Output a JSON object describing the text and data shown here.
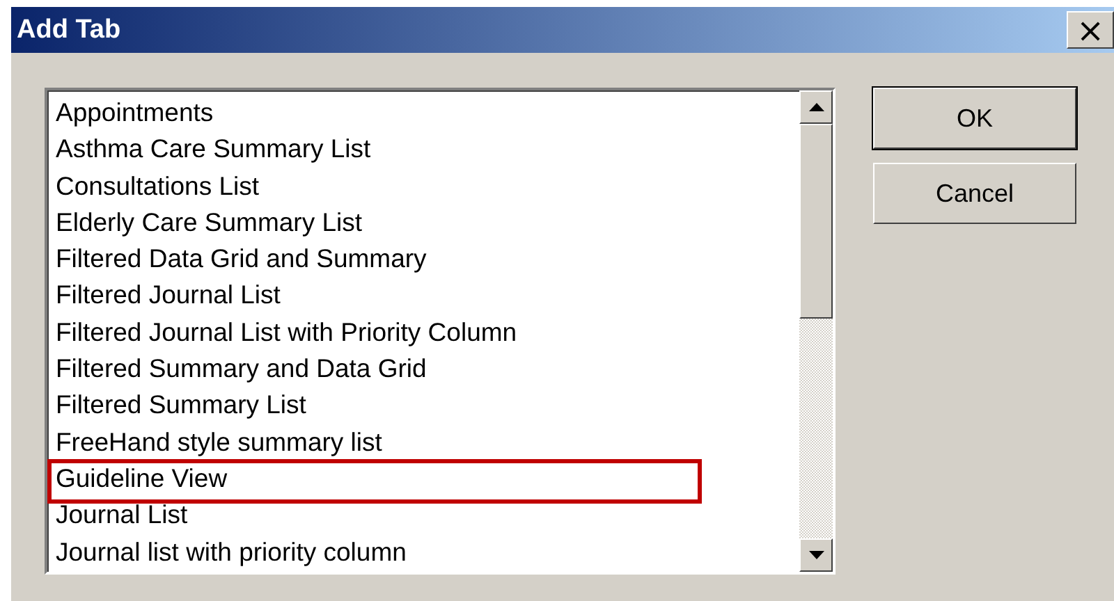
{
  "window": {
    "title": "Add Tab",
    "close": "×"
  },
  "list": {
    "items": [
      {
        "label": "Appointments",
        "highlighted": false
      },
      {
        "label": "Asthma Care Summary List",
        "highlighted": false
      },
      {
        "label": "Consultations List",
        "highlighted": false
      },
      {
        "label": "Elderly Care Summary List",
        "highlighted": false
      },
      {
        "label": "Filtered Data Grid and Summary",
        "highlighted": false
      },
      {
        "label": "Filtered Journal List",
        "highlighted": false
      },
      {
        "label": "Filtered Journal List with Priority Column",
        "highlighted": false
      },
      {
        "label": "Filtered Summary and Data Grid",
        "highlighted": false
      },
      {
        "label": "Filtered Summary List",
        "highlighted": false
      },
      {
        "label": "FreeHand style summary list",
        "highlighted": false
      },
      {
        "label": "Guideline View",
        "highlighted": true
      },
      {
        "label": "Journal List",
        "highlighted": false
      },
      {
        "label": "Journal list with priority column",
        "highlighted": false
      }
    ]
  },
  "buttons": [
    "OK",
    "Cancel"
  ]
}
